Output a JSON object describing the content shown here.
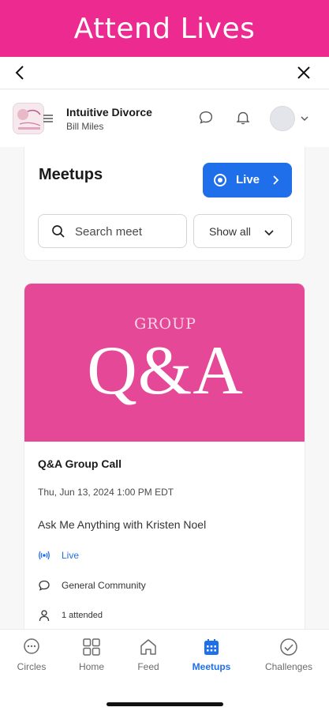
{
  "banner": {
    "title": "Attend Lives"
  },
  "header": {
    "community_name": "Intuitive Divorce",
    "owner": "Bill Miles"
  },
  "meetups": {
    "title": "Meetups",
    "live_button": "Live",
    "search_placeholder": "Search meet",
    "filter_label": "Show all"
  },
  "event": {
    "cover_small": "GROUP",
    "cover_big": "Q&A",
    "title": "Q&A Group Call",
    "datetime": "Thu, Jun 13, 2024 1:00 PM EDT",
    "description": "Ask Me Anything with Kristen Noel",
    "status": "Live",
    "space": "General Community",
    "attendance": "1 attended"
  },
  "tabs": [
    {
      "label": "Circles",
      "icon": "circles-icon",
      "active": false
    },
    {
      "label": "Home",
      "icon": "grid-icon",
      "active": false
    },
    {
      "label": "Feed",
      "icon": "house-icon",
      "active": false
    },
    {
      "label": "Meetups",
      "icon": "calendar-icon",
      "active": true
    },
    {
      "label": "Challenges",
      "icon": "check-circle-icon",
      "active": false
    }
  ],
  "colors": {
    "brand_pink": "#ec2a8f",
    "accent_blue": "#1f6feb",
    "cover_pink": "#e54896"
  }
}
